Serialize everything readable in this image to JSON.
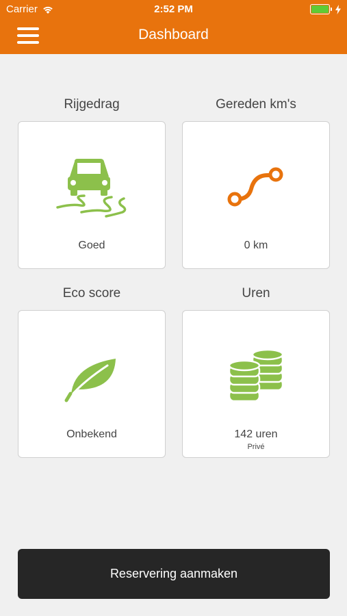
{
  "status_bar": {
    "carrier": "Carrier",
    "time": "2:52 PM",
    "wifi_icon": "wifi-icon",
    "battery_icon": "battery-icon",
    "charging_icon": "charging-bolt-icon"
  },
  "header": {
    "title": "Dashboard",
    "menu_icon": "hamburger-menu-icon",
    "background_color": "#e8730d"
  },
  "tiles": [
    {
      "label": "Rijgedrag",
      "value": "Goed",
      "icon": "skidding-car-icon",
      "icon_color": "#8cc04b"
    },
    {
      "label": "Gereden km's",
      "value": "0 km",
      "icon": "route-icon",
      "icon_color": "#e8730d"
    },
    {
      "label": "Eco score",
      "value": "Onbekend",
      "icon": "leaf-icon",
      "icon_color": "#8cc04b"
    },
    {
      "label": "Uren",
      "value": "142 uren",
      "sub": "Privé",
      "icon": "coins-stack-icon",
      "icon_color": "#8cc04b"
    }
  ],
  "cta": {
    "label": "Reservering aanmaken"
  }
}
